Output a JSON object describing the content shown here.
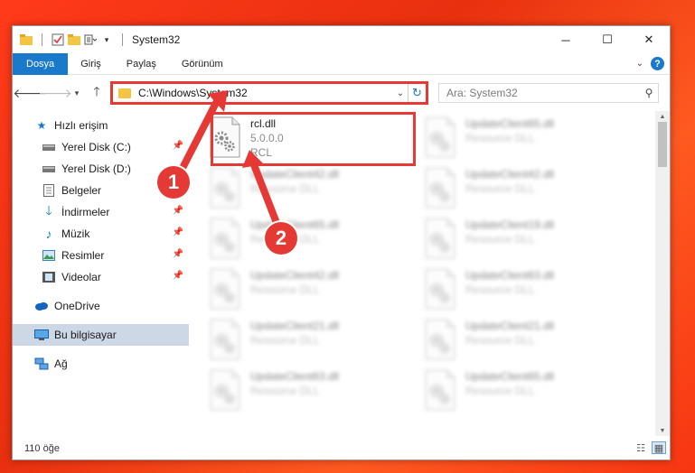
{
  "window": {
    "title": "System32"
  },
  "ribbon": {
    "tabs": [
      "Dosya",
      "Giriş",
      "Paylaş",
      "Görünüm"
    ]
  },
  "nav": {
    "address": "C:\\Windows\\System32",
    "search_placeholder": "Ara: System32"
  },
  "sidebar": {
    "items": [
      {
        "label": "Hızlı erişim",
        "icon": "star-icon"
      },
      {
        "label": "Yerel Disk (C:)",
        "icon": "drive-icon",
        "pinned": true
      },
      {
        "label": "Yerel Disk (D:)",
        "icon": "drive-icon"
      },
      {
        "label": "Belgeler",
        "icon": "documents-icon",
        "pinned": true
      },
      {
        "label": "İndirmeler",
        "icon": "download-icon",
        "pinned": true
      },
      {
        "label": "Müzik",
        "icon": "music-icon",
        "pinned": true
      },
      {
        "label": "Resimler",
        "icon": "pictures-icon",
        "pinned": true
      },
      {
        "label": "Videolar",
        "icon": "videos-icon",
        "pinned": true
      },
      {
        "label": "OneDrive",
        "icon": "cloud-icon"
      },
      {
        "label": "Bu bilgisayar",
        "icon": "computer-icon",
        "selected": true
      },
      {
        "label": "Ağ",
        "icon": "network-icon"
      }
    ]
  },
  "files": [
    {
      "name": "rcl.dll",
      "line2": "5.0.0.0",
      "line3": "RCL",
      "clear": true
    },
    {
      "name": "UpdateClient65.dll",
      "line2": "Resource DLL"
    },
    {
      "name": "UpdateClient42.dll",
      "line2": "Resource DLL"
    },
    {
      "name": "UpdateClient42.dll",
      "line2": "Resource DLL"
    },
    {
      "name": "UpdateClient65.dll",
      "line2": "Resource DLL"
    },
    {
      "name": "UpdateClient19.dll",
      "line2": "Resource DLL"
    },
    {
      "name": "UpdateClient42.dll",
      "line2": "Resource DLL"
    },
    {
      "name": "UpdateClient63.dll",
      "line2": "Resource DLL"
    },
    {
      "name": "UpdateClient21.dll",
      "line2": "Resource DLL"
    },
    {
      "name": "UpdateClient21.dll",
      "line2": "Resource DLL"
    },
    {
      "name": "UpdateClient63.dll",
      "line2": "Resource DLL"
    },
    {
      "name": "UpdateClient65.dll",
      "line2": "Resource DLL"
    }
  ],
  "status": {
    "count": "110 öğe"
  },
  "callouts": [
    "1",
    "2"
  ],
  "colors": {
    "accent": "#1979ca",
    "annotation": "#e53935"
  }
}
